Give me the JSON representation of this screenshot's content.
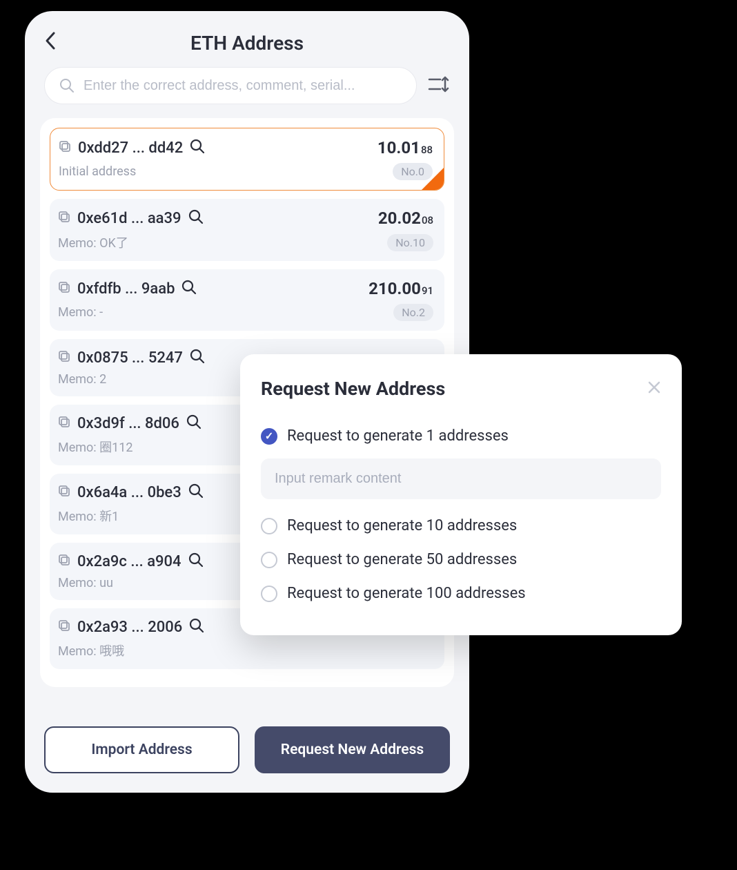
{
  "header": {
    "title": "ETH Address"
  },
  "search": {
    "placeholder": "Enter the correct address, comment, serial..."
  },
  "addresses": [
    {
      "addr": "0xdd27 ... dd42",
      "balance": "10.01",
      "balance_sub": "88",
      "memo": "Initial address",
      "badge": "No.0",
      "selected": true
    },
    {
      "addr": "0xe61d ... aa39",
      "balance": "20.02",
      "balance_sub": "08",
      "memo": "Memo: OK了",
      "badge": "No.10",
      "selected": false
    },
    {
      "addr": "0xfdfb ... 9aab",
      "balance": "210.00",
      "balance_sub": "91",
      "memo": "Memo: -",
      "badge": "No.2",
      "selected": false
    },
    {
      "addr": "0x0875 ... 5247",
      "balance": "",
      "balance_sub": "",
      "memo": "Memo: 2",
      "badge": "",
      "selected": false
    },
    {
      "addr": "0x3d9f ... 8d06",
      "balance": "",
      "balance_sub": "",
      "memo": "Memo: 圈112",
      "badge": "",
      "selected": false
    },
    {
      "addr": "0x6a4a ... 0be3",
      "balance": "",
      "balance_sub": "",
      "memo": "Memo: 新1",
      "badge": "",
      "selected": false
    },
    {
      "addr": "0x2a9c ... a904",
      "balance": "",
      "balance_sub": "",
      "memo": "Memo: uu",
      "badge": "",
      "selected": false
    },
    {
      "addr": "0x2a93 ... 2006",
      "balance": "",
      "balance_sub": "",
      "memo": "Memo: 哦哦",
      "badge": "",
      "selected": false
    }
  ],
  "buttons": {
    "import": "Import Address",
    "request": "Request New Address"
  },
  "modal": {
    "title": "Request New Address",
    "remark_placeholder": "Input remark content",
    "options": [
      {
        "label": "Request to generate 1 addresses",
        "checked": true
      },
      {
        "label": "Request to generate 10 addresses",
        "checked": false
      },
      {
        "label": "Request to generate 50 addresses",
        "checked": false
      },
      {
        "label": "Request to generate 100 addresses",
        "checked": false
      }
    ]
  }
}
